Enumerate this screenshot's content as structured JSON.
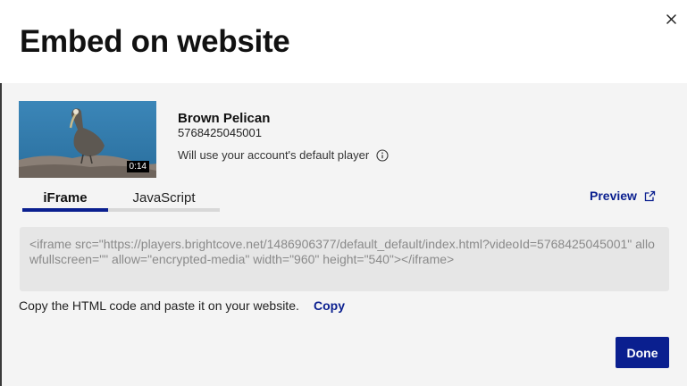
{
  "dialog": {
    "title": "Embed on website"
  },
  "video": {
    "name": "Brown Pelican",
    "id": "5768425045001",
    "duration": "0:14",
    "player_note": "Will use your account's default player"
  },
  "tabs": [
    {
      "label": "iFrame",
      "active": true
    },
    {
      "label": "JavaScript",
      "active": false
    }
  ],
  "preview_label": "Preview",
  "embed_code": "<iframe src=\"https://players.brightcove.net/1486906377/default_default/index.html?videoId=5768425045001\" allowfullscreen=\"\" allow=\"encrypted-media\" width=\"960\" height=\"540\"></iframe>",
  "copy_instructions": "Copy the HTML code and paste it on your website.",
  "copy_label": "Copy",
  "done_label": "Done",
  "colors": {
    "accent": "#0a1f8f",
    "panel_bg": "#f4f4f4",
    "code_bg": "#e6e6e6"
  },
  "icons": {
    "close": "close-icon",
    "info": "info-icon",
    "external": "external-link-icon"
  }
}
